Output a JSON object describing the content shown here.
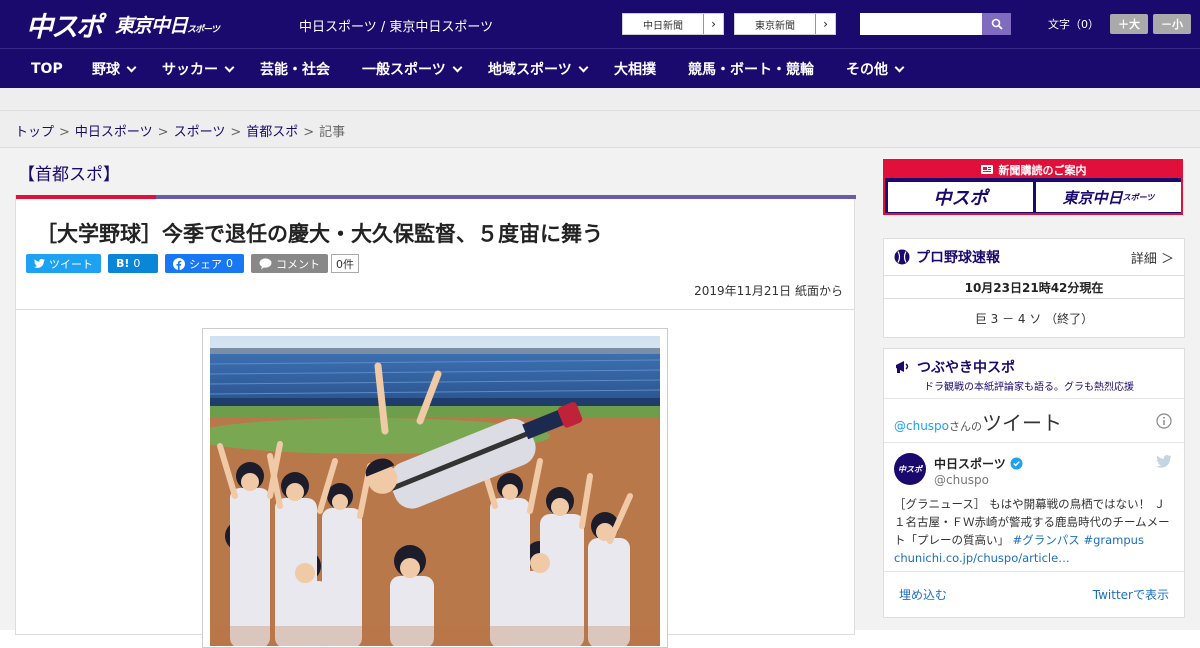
{
  "header": {
    "logo_main": "中スポ",
    "logo_sub": "東京中日",
    "logo_sub_small": "スポーツ",
    "site_name": "中日スポーツ / 東京中日スポーツ",
    "paper_links": [
      {
        "label": "中日新聞",
        "arrow": "›"
      },
      {
        "label": "東京新聞",
        "arrow": "›"
      }
    ],
    "search_placeholder": "",
    "font_label": "文字（0）",
    "font_larger": "＋大",
    "font_smaller": "－小"
  },
  "nav": {
    "items": [
      {
        "label": "TOP",
        "has_menu": false
      },
      {
        "label": "野球",
        "has_menu": true
      },
      {
        "label": "サッカー",
        "has_menu": true
      },
      {
        "label": "芸能・社会",
        "has_menu": false
      },
      {
        "label": "一般スポーツ",
        "has_menu": true
      },
      {
        "label": "地域スポーツ",
        "has_menu": true
      },
      {
        "label": "大相撲",
        "has_menu": false
      },
      {
        "label": "競馬・ボート・競輪",
        "has_menu": false
      },
      {
        "label": "その他",
        "has_menu": true
      }
    ]
  },
  "breadcrumb": {
    "items": [
      "トップ",
      "中日スポーツ",
      "スポーツ",
      "首都スポ"
    ],
    "current": "記事",
    "separator": ">"
  },
  "section_title": "【首都スポ】",
  "article": {
    "headline": "［大学野球］今季で退任の慶大・大久保監督、５度宙に舞う",
    "share": {
      "tweet": "ツイート",
      "hatena_label": "B!",
      "hatena_count": "0",
      "facebook": "シェア",
      "facebook_count": "0",
      "comment": "コメント",
      "comment_count": "0件"
    },
    "date": "2019年11月21日 紙面から"
  },
  "sidebar": {
    "subscribe": {
      "title": "新聞購読のご案内",
      "left": "中スポ",
      "right": "東京中日",
      "right_small": "スポーツ"
    },
    "baseball": {
      "title": "プロ野球速報",
      "more": "詳細 ＞",
      "time": "10月23日21時42分現在",
      "score": "巨 3 － 4 ソ （終了）"
    },
    "tweets": {
      "title": "つぶやき中スポ",
      "subtitle": "ドラ観戦の本紙評論家も語る。グラも熱烈応援",
      "handle_prefix": "@chuspo",
      "handle_suffix": "さんの",
      "tweet_word": "ツイート",
      "author": "中日スポーツ",
      "author_handle": "@chuspo",
      "avatar_text": "中スポ",
      "body": "［グラニュース］ もはや開幕戦の鳥栖ではない！ Ｊ１名古屋・ＦＷ赤崎が警戒する鹿島時代のチームメート「プレーの質高い」",
      "hashtag1": "#グランパス",
      "hashtag2": "#grampus",
      "link": "chunichi.co.jp/chuspo/article…",
      "embed": "埋め込む",
      "view_on": "Twitterで表示"
    }
  },
  "colors": {
    "brand_navy": "#1b0a6e",
    "accent_red": "#e0103a",
    "twitter": "#1da1f2"
  }
}
